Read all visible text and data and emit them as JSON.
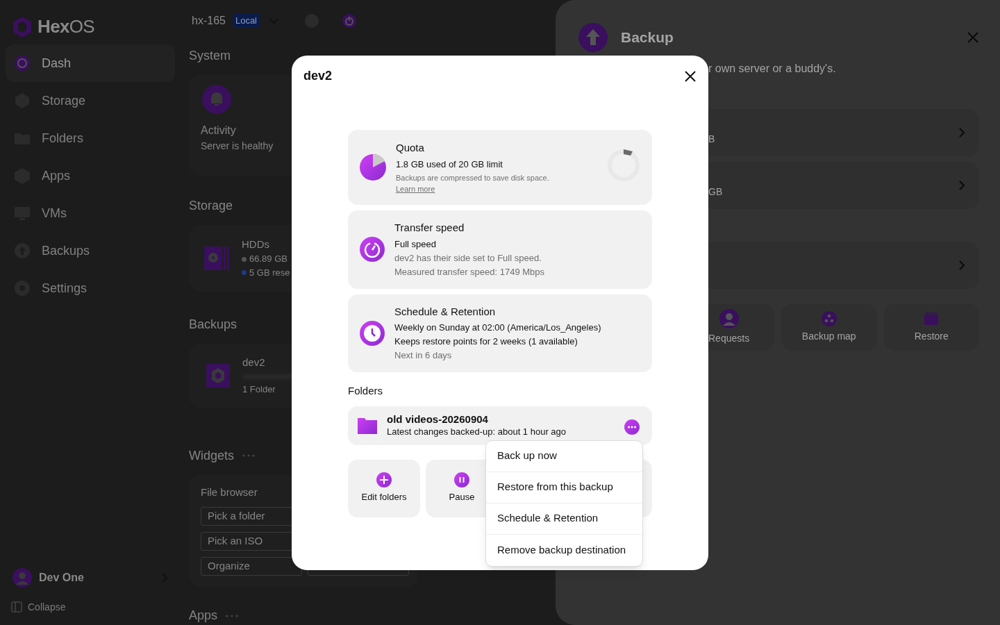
{
  "sidebar": {
    "logo": "**Hex**OS",
    "nav": [
      {
        "label": "Dash",
        "kind": "dash",
        "selected": true
      },
      {
        "label": "Storage",
        "kind": "storage",
        "selected": false
      },
      {
        "label": "Folders",
        "kind": "folders",
        "selected": false
      },
      {
        "label": "Apps",
        "kind": "apps",
        "selected": false
      },
      {
        "label": "VMs",
        "kind": "vms",
        "selected": false
      },
      {
        "label": "Backups",
        "kind": "backups",
        "selected": false
      },
      {
        "label": "Settings",
        "kind": "settings",
        "selected": false
      }
    ],
    "user": "Dev One",
    "collapse": "Collapse"
  },
  "topbar": {
    "server": "hx-165",
    "badge": "Local"
  },
  "system": {
    "title": "System",
    "card_title": "Activity",
    "card_subtitle": "Server is healthy"
  },
  "storage": {
    "title": "Storage",
    "card_title": "HDDs",
    "stats": [
      {
        "text": "66.89 GB",
        "color": "#555555"
      },
      {
        "text": "5 GB rese",
        "color": "#1e3a8a"
      }
    ]
  },
  "backups": {
    "title": "Backups",
    "card_title": "dev2",
    "card_subtitle": "1 Folder"
  },
  "widgets": {
    "title": "Widgets",
    "card_title": "File browser",
    "buttons": [
      "Pick a folder",
      "Pick an ISO",
      "Organize"
    ]
  },
  "apps": {
    "title": "Apps"
  },
  "drawer": {
    "title": "Backup",
    "description": "r own server or a buddy's.",
    "destinations": [
      {
        "detail": "B"
      },
      {
        "detail": "GB"
      }
    ],
    "tiles": [
      {
        "label": "Requests",
        "kind": "requests"
      },
      {
        "label": "Backup map",
        "kind": "map"
      },
      {
        "label": "Restore",
        "kind": "restore"
      }
    ]
  },
  "modal": {
    "title": "dev2",
    "cards": [
      {
        "kind": "quota",
        "title": "Quota",
        "lines": [
          {
            "text": "1.8 GB used of 20 GB limit",
            "muted": false
          }
        ],
        "note": "Backups are compressed to save disk space.",
        "link": "Learn more"
      },
      {
        "kind": "speed",
        "title": "Transfer speed",
        "lines": [
          {
            "text": "Full speed",
            "muted": false
          },
          {
            "text": "dev2 has their side set to Full speed.",
            "muted": true
          },
          {
            "text": "Measured transfer speed: 1749 Mbps",
            "muted": true
          }
        ]
      },
      {
        "kind": "schedule",
        "title": "Schedule & Retention",
        "lines": [
          {
            "text": "Weekly on Sunday at 02:00 (America/Los_Angeles)",
            "muted": false
          },
          {
            "text": "Keeps restore points for 2 weeks (1 available)",
            "muted": false
          },
          {
            "text": "Next in 6 days",
            "muted": true
          }
        ]
      }
    ],
    "folders_title": "Folders",
    "folders": [
      {
        "name": "old videos-20260904",
        "status": "Latest changes backed-up: about 1 hour ago"
      }
    ],
    "actions": [
      {
        "label": "Edit folders",
        "kind": "add"
      },
      {
        "label": "Pause",
        "kind": "pause"
      }
    ],
    "menu": [
      "Back up now",
      "Restore from this backup",
      "Schedule & Retention",
      "Remove backup destination"
    ]
  }
}
